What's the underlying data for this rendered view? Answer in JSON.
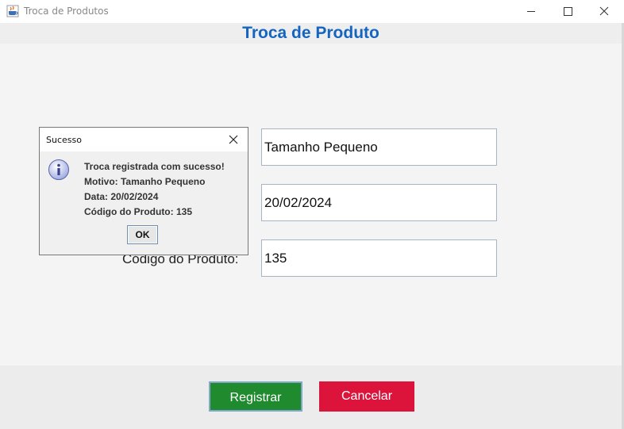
{
  "window": {
    "title": "Troca de Produtos",
    "app_icon": "java-cup-icon",
    "controls": [
      "minimize-icon",
      "maximize-icon",
      "close-icon"
    ]
  },
  "header": {
    "title": "Troca de Produto",
    "title_color": "#1565c0"
  },
  "form": {
    "motivo": {
      "value": "Tamanho Pequeno"
    },
    "data": {
      "value": "20/02/2024"
    },
    "codigo": {
      "label": "Código do Produto:",
      "value": "135"
    }
  },
  "buttons": {
    "registrar": {
      "label": "Registrar",
      "color": "#1f8b2e"
    },
    "cancelar": {
      "label": "Cancelar",
      "color": "#dc143c"
    }
  },
  "dialog": {
    "title": "Sucesso",
    "icon": "info-icon",
    "lines": [
      "Troca registrada com sucesso!",
      "Motivo: Tamanho Pequeno",
      "Data: 20/02/2024",
      "Código do Produto: 135"
    ],
    "ok_label": "OK"
  }
}
